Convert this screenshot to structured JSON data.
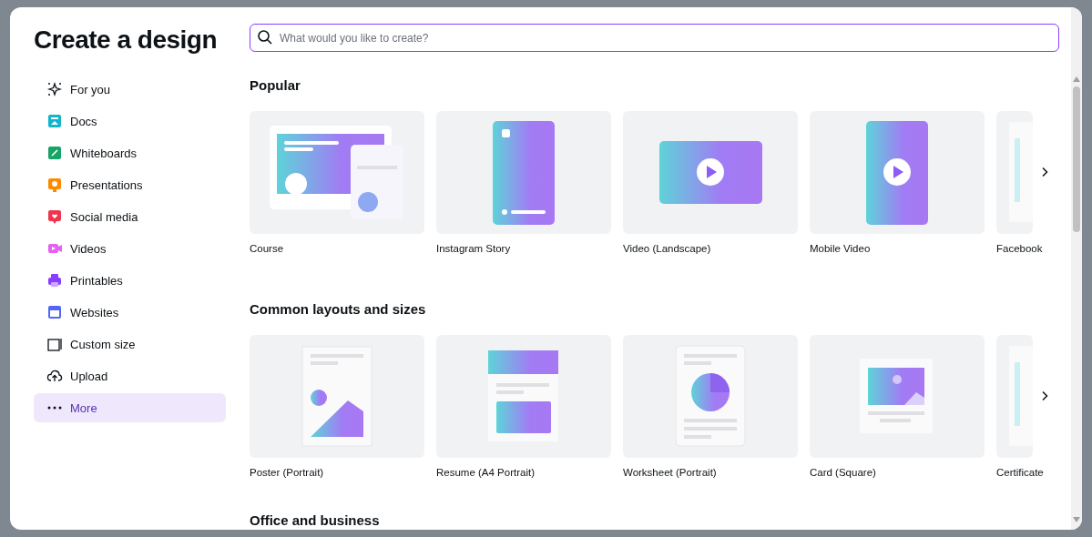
{
  "title": "Create a design",
  "sidebar": {
    "items": [
      {
        "label": "For you",
        "kind": "sparkle",
        "selected": false
      },
      {
        "label": "Docs",
        "kind": "docs",
        "selected": false
      },
      {
        "label": "Whiteboards",
        "kind": "whiteboard",
        "selected": false
      },
      {
        "label": "Presentations",
        "kind": "presentation",
        "selected": false
      },
      {
        "label": "Social media",
        "kind": "social",
        "selected": false
      },
      {
        "label": "Videos",
        "kind": "video",
        "selected": false
      },
      {
        "label": "Printables",
        "kind": "print",
        "selected": false
      },
      {
        "label": "Websites",
        "kind": "web",
        "selected": false
      },
      {
        "label": "Custom size",
        "kind": "resize",
        "selected": false
      },
      {
        "label": "Upload",
        "kind": "upload",
        "selected": false
      },
      {
        "label": "More",
        "kind": "more",
        "selected": true
      }
    ]
  },
  "search": {
    "placeholder": "What would you like to create?"
  },
  "sections": [
    {
      "heading": "Popular",
      "cards": [
        {
          "label": "Course",
          "kind": "course"
        },
        {
          "label": "Instagram Story",
          "kind": "story"
        },
        {
          "label": "Video (Landscape)",
          "kind": "landscape-video"
        },
        {
          "label": "Mobile Video",
          "kind": "mobile-video"
        },
        {
          "label": "Facebook",
          "kind": "partial"
        }
      ]
    },
    {
      "heading": "Common layouts and sizes",
      "cards": [
        {
          "label": "Poster (Portrait)",
          "kind": "poster"
        },
        {
          "label": "Resume (A4 Portrait)",
          "kind": "resume"
        },
        {
          "label": "Worksheet (Portrait)",
          "kind": "worksheet"
        },
        {
          "label": "Card (Square)",
          "kind": "card"
        },
        {
          "label": "Certificate",
          "kind": "partial"
        }
      ]
    },
    {
      "heading": "Office and business"
    }
  ]
}
